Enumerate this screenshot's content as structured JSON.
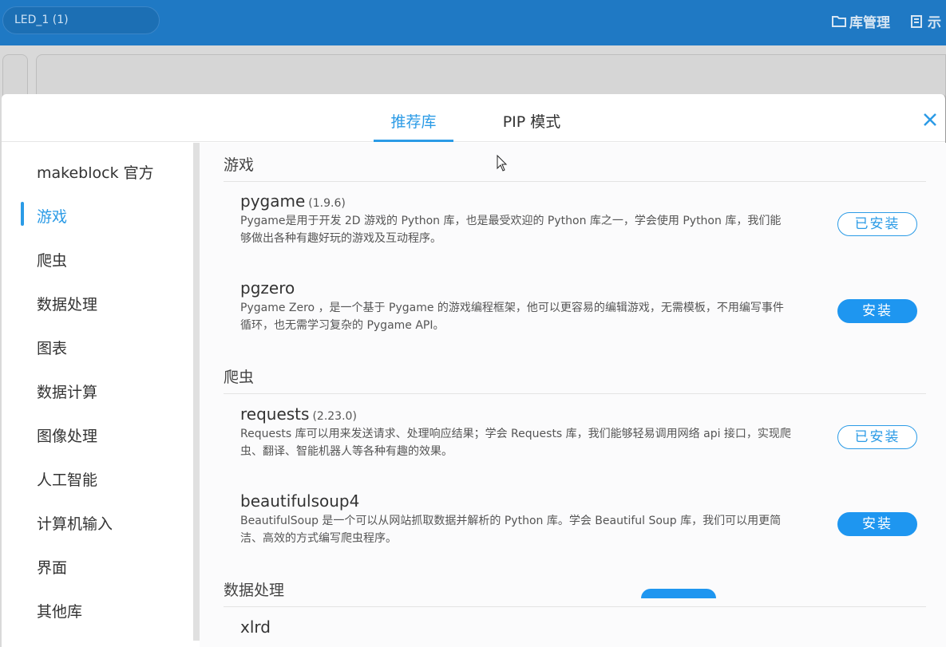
{
  "topbar": {
    "file_tab": "LED_1 (1)",
    "lib_manage": "库管理",
    "demo": "示"
  },
  "modal": {
    "tabs": [
      {
        "label": "推荐库",
        "active": true
      },
      {
        "label": "PIP 模式",
        "active": false
      }
    ],
    "sidebar": [
      {
        "label": "makeblock 官方"
      },
      {
        "label": "游戏",
        "active": true
      },
      {
        "label": "爬虫"
      },
      {
        "label": "数据处理"
      },
      {
        "label": "图表"
      },
      {
        "label": "数据计算"
      },
      {
        "label": "图像处理"
      },
      {
        "label": "人工智能"
      },
      {
        "label": "计算机输入"
      },
      {
        "label": "界面"
      },
      {
        "label": "其他库"
      }
    ],
    "sections": [
      {
        "title": "游戏",
        "libs": [
          {
            "name": "pygame",
            "version": "(1.9.6)",
            "desc": "Pygame是用于开发 2D 游戏的 Python 库，也是最受欢迎的 Python 库之一，学会使用 Python 库，我们能够做出各种有趣好玩的游戏及互动程序。",
            "button": "已安装"
          },
          {
            "name": "pgzero",
            "version": "",
            "desc": "Pygame Zero ，是一个基于 Pygame 的游戏编程框架，他可以更容易的编辑游戏，无需模板，不用编写事件循环，也无需学习复杂的 Pygame API。",
            "button": "安装"
          }
        ]
      },
      {
        "title": "爬虫",
        "libs": [
          {
            "name": "requests",
            "version": "(2.23.0)",
            "desc": "Requests 库可以用来发送请求、处理响应结果；学会 Requests 库，我们能够轻易调用网络 api 接口，实现爬虫、翻译、智能机器人等各种有趣的效果。",
            "button": "已安装"
          },
          {
            "name": "beautifulsoup4",
            "version": "",
            "desc": "BeautifulSoup 是一个可以从网站抓取数据并解析的 Python 库。学会 Beautiful Soup 库，我们可以用更简洁、高效的方式编写爬虫程序。",
            "button": "安装"
          }
        ]
      },
      {
        "title": "数据处理",
        "libs": [
          {
            "name": "xlrd",
            "version": ""
          }
        ]
      }
    ]
  }
}
